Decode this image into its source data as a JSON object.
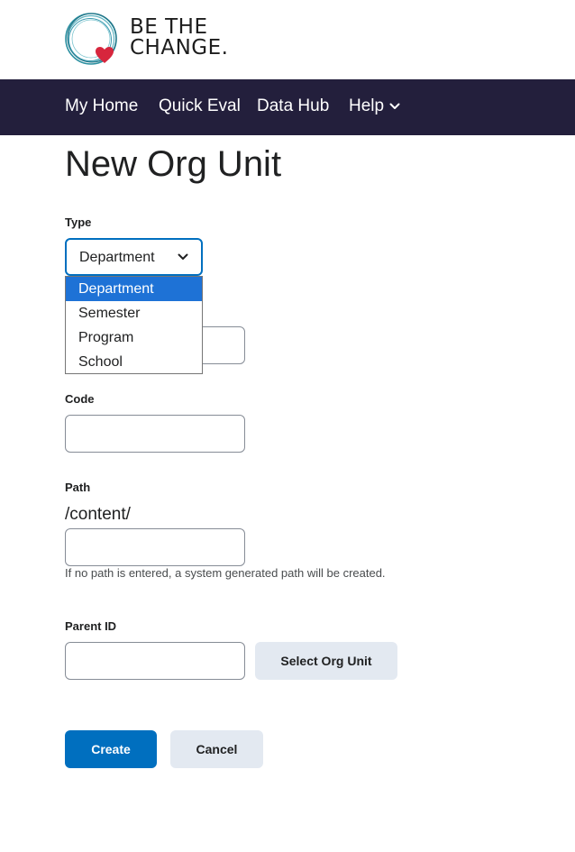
{
  "brand": {
    "line1": "BE THE",
    "line2": "CHANGE.",
    "icon": "ring-heart-logo-icon",
    "heart_color": "#d7263d",
    "ring_color": "#2a8fa0"
  },
  "nav": {
    "background": "#231f3c",
    "items": [
      {
        "label": "My Home"
      },
      {
        "label": "Quick Eval"
      },
      {
        "label": "Data Hub"
      },
      {
        "label": "Help",
        "icon": "chevron-down-icon"
      }
    ]
  },
  "page": {
    "title": "New Org Unit"
  },
  "form": {
    "type": {
      "label": "Type",
      "value": "Department",
      "options": [
        "Department",
        "Semester",
        "Program",
        "School"
      ],
      "selected_index": 0
    },
    "name": {
      "value": ""
    },
    "code": {
      "label": "Code",
      "value": ""
    },
    "path": {
      "label": "Path",
      "prefix": "/content/",
      "value": "",
      "help": "If no path is entered, a system generated path will be created."
    },
    "parent_id": {
      "label": "Parent ID",
      "value": "",
      "select_button": "Select Org Unit"
    }
  },
  "actions": {
    "create": "Create",
    "cancel": "Cancel",
    "primary_color": "#006fbf"
  }
}
